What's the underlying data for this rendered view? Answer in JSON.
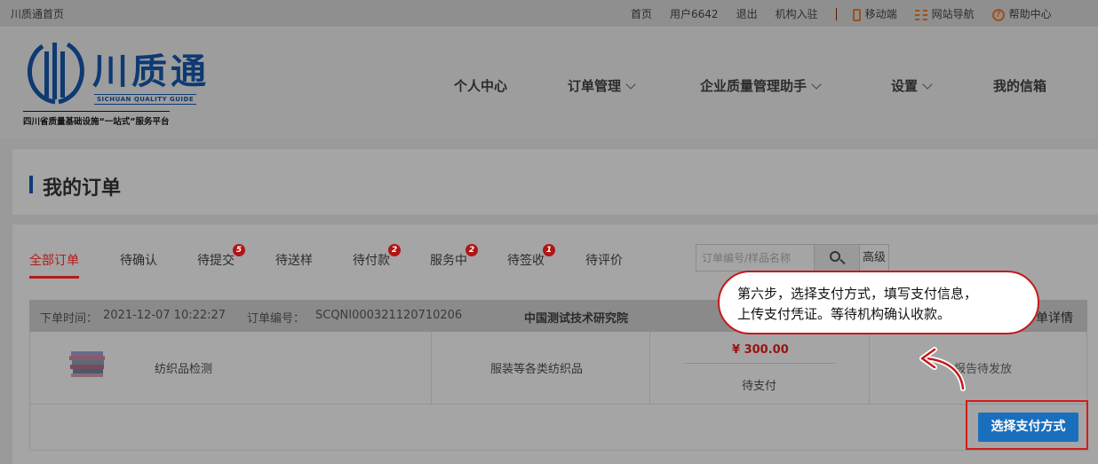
{
  "topbar": {
    "home": "川质通首页",
    "links": [
      "首页",
      "用户6642",
      "退出",
      "机构入驻"
    ],
    "mobile": "移动端",
    "sitenav": "网站导航",
    "help": "帮助中心"
  },
  "logo": {
    "name": "川质通",
    "en": "SICHUAN QUALITY GUIDE",
    "slogan": "四川省质量基础设施“一站式”服务平台"
  },
  "nav": {
    "personal": "个人中心",
    "orders": "订单管理",
    "assistant": "企业质量管理助手",
    "settings": "设置",
    "mailbox": "我的信箱"
  },
  "page": {
    "title": "我的订单"
  },
  "tabs": [
    {
      "label": "全部订单",
      "badge": ""
    },
    {
      "label": "待确认",
      "badge": ""
    },
    {
      "label": "待提交",
      "badge": "5"
    },
    {
      "label": "待送样",
      "badge": ""
    },
    {
      "label": "待付款",
      "badge": "2"
    },
    {
      "label": "服务中",
      "badge": "2"
    },
    {
      "label": "待签收",
      "badge": "1"
    },
    {
      "label": "待评价",
      "badge": ""
    }
  ],
  "search": {
    "placeholder": "订单编号/样品名称",
    "advanced": "高级"
  },
  "order": {
    "time_label": "下单时间：",
    "time": "2021-12-07 10:22:27",
    "no_label": "订单编号：",
    "no": "SCQNI000321120710206",
    "institution": "中国测试技术研究院",
    "detail": "单详情",
    "item": "纺织品检测",
    "category": "服装等各类纺织品",
    "price": "¥ 300.00",
    "status": "待支付",
    "report": "报告待发放",
    "pay_button": "选择支付方式"
  },
  "callout": {
    "line1": "第六步，选择支付方式，填写支付信息，",
    "line2": "上传支付凭证。等待机构确认收款。"
  },
  "colors": {
    "accent_red": "#c21b1b",
    "button_blue": "#1a6fbd",
    "brand_navy": "#0e3a73"
  }
}
